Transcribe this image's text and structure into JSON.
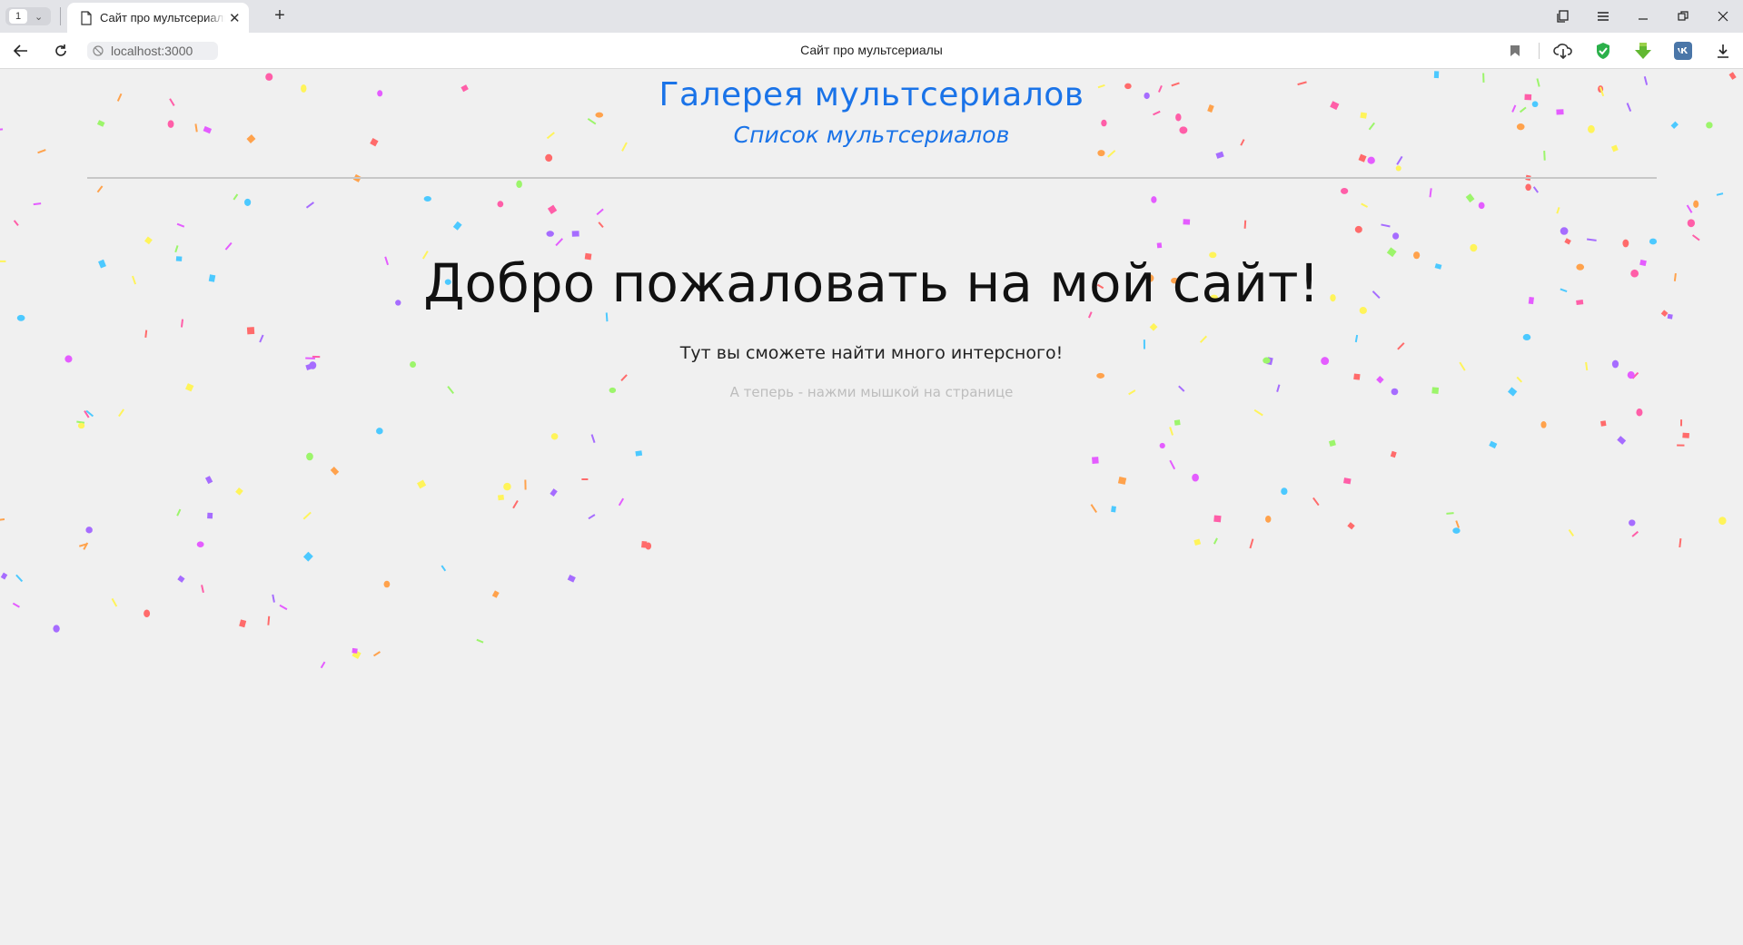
{
  "browser": {
    "tab_count": "1",
    "active_tab_title": "Сайт про мультсериалы",
    "url": "localhost:3000",
    "page_title": "Сайт про мультсериалы",
    "icons": [
      "bookmark-icon",
      "cloud-download-icon",
      "shield-icon",
      "extension-icon",
      "vk-icon",
      "download-icon"
    ]
  },
  "page": {
    "gallery_title": "Галерея мультсериалов",
    "list_link": "Список мультсериалов",
    "welcome": "Добро пожаловать на мой сайт!",
    "subtitle": "Тут вы сможете найти много интерсного!",
    "hint": "А теперь - нажми мышкой на странице"
  },
  "colors": {
    "link": "#1a73e8",
    "confetti": [
      "#a66cff",
      "#ff5ea8",
      "#ffa24c",
      "#4cc9ff",
      "#9cf56b",
      "#fff45a",
      "#ff6b6b",
      "#e45cff"
    ]
  }
}
